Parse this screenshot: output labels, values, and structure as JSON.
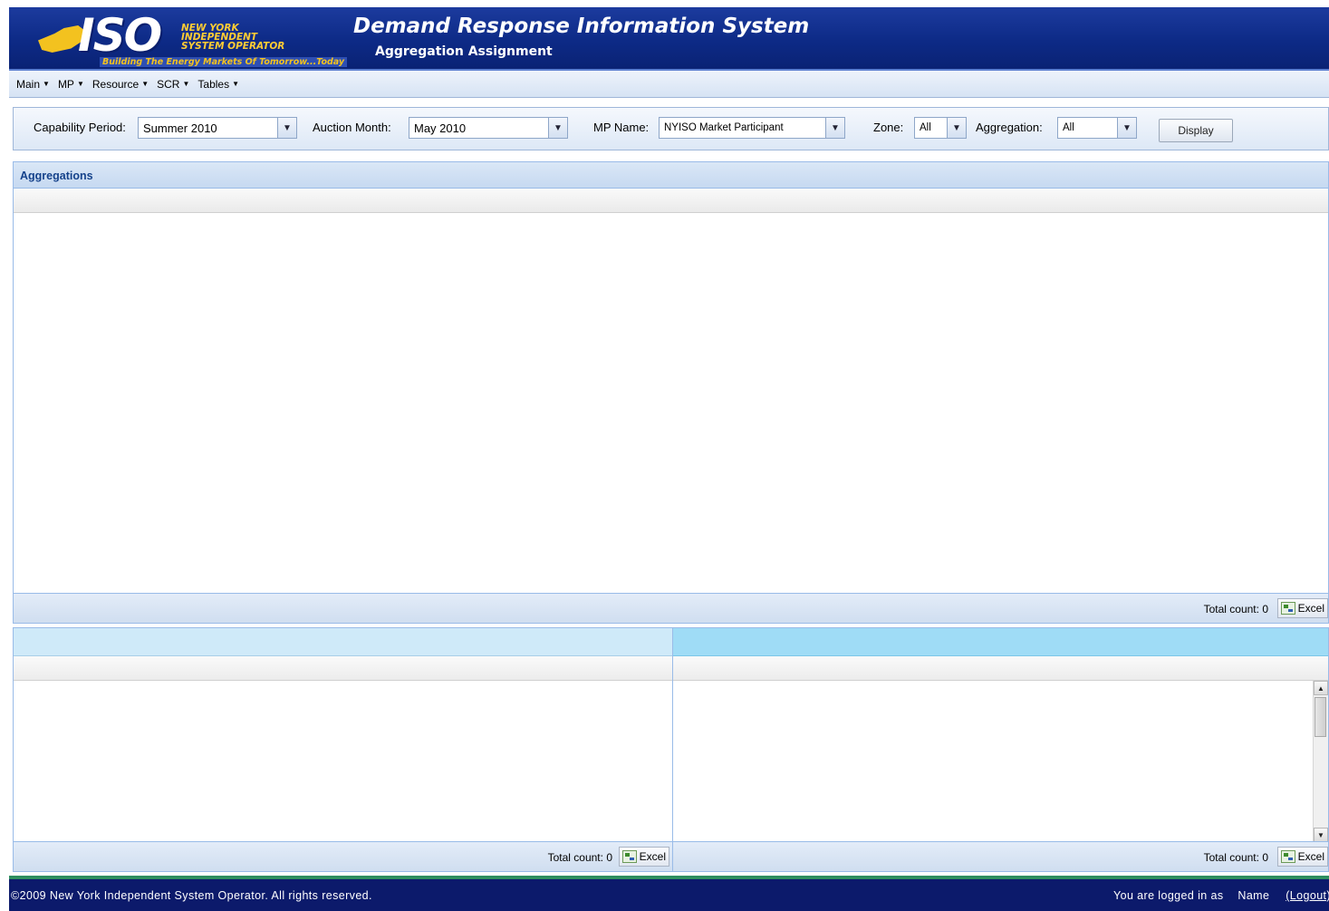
{
  "header": {
    "logo_text": "ISO",
    "logo_subtitle": "NEW YORK\nINDEPENDENT\nSYSTEM OPERATOR",
    "logo_tagline": "Building The Energy Markets Of Tomorrow...Today",
    "app_title": "Demand Response Information System",
    "page_title": "Aggregation Assignment"
  },
  "menu": {
    "items": [
      {
        "label": "Main"
      },
      {
        "label": "MP"
      },
      {
        "label": "Resource"
      },
      {
        "label": "SCR"
      },
      {
        "label": "Tables"
      }
    ]
  },
  "filters": {
    "capability_period": {
      "label": "Capability Period:",
      "value": "Summer 2010"
    },
    "auction_month": {
      "label": "Auction Month:",
      "value": "May 2010"
    },
    "mp_name": {
      "label": "MP Name:",
      "value": "NYISO Market Participant"
    },
    "zone": {
      "label": "Zone:",
      "value": "All"
    },
    "aggregation": {
      "label": "Aggregation:",
      "value": "All"
    },
    "display_label": "Display"
  },
  "aggregations_panel": {
    "title": "Aggregations",
    "total_count_label": "Total count:",
    "total_count": "0",
    "excel_label": "Excel"
  },
  "bottom_left": {
    "total_count_label": "Total count:",
    "total_count": "0",
    "excel_label": "Excel"
  },
  "bottom_right": {
    "total_count_label": "Total count:",
    "total_count": "0",
    "excel_label": "Excel"
  },
  "footer": {
    "copyright": "©2009   New York Independent System Operator. All rights reserved.",
    "logged_in_label": "You are logged in as",
    "user_name": "Name",
    "logout_label": "(Logout)"
  },
  "colors": {
    "header_blue": "#0d2a86",
    "panel_title": "#15428b",
    "accent_yellow": "#f3c21f",
    "footer_navy": "#0c1a6b"
  }
}
